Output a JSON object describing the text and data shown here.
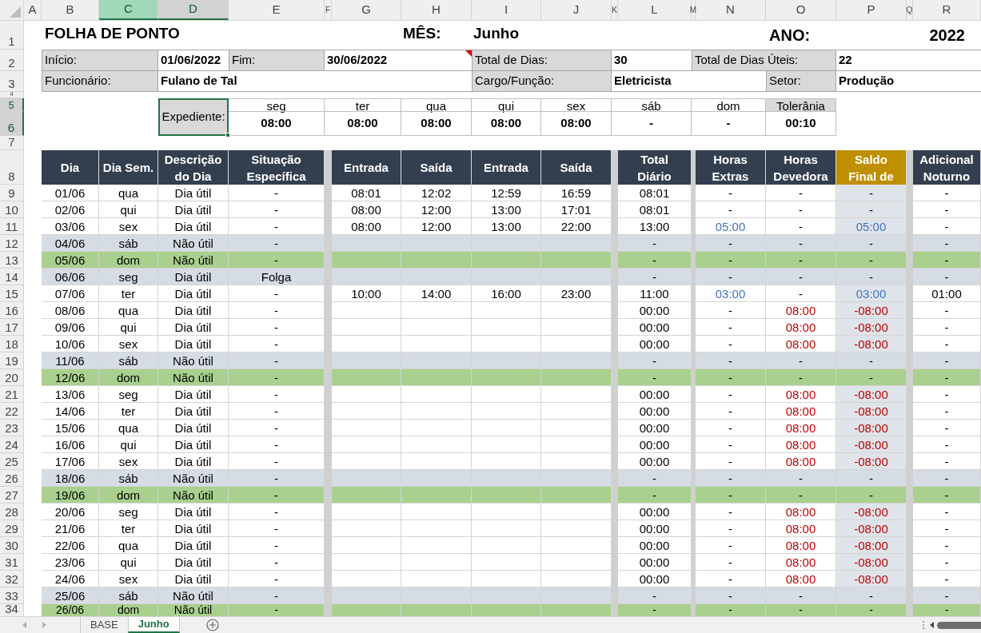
{
  "column_headers": [
    {
      "label": "A",
      "selected": false,
      "highlighted": false
    },
    {
      "label": "B",
      "selected": false,
      "highlighted": false
    },
    {
      "label": "C",
      "selected": true,
      "highlighted": true
    },
    {
      "label": "D",
      "selected": false,
      "highlighted": true
    },
    {
      "label": "E",
      "selected": false,
      "highlighted": false
    },
    {
      "label": "F",
      "selected": false,
      "highlighted": false
    },
    {
      "label": "G",
      "selected": false,
      "highlighted": false
    },
    {
      "label": "H",
      "selected": false,
      "highlighted": false
    },
    {
      "label": "I",
      "selected": false,
      "highlighted": false
    },
    {
      "label": "J",
      "selected": false,
      "highlighted": false
    },
    {
      "label": "K",
      "selected": false,
      "highlighted": false
    },
    {
      "label": "L",
      "selected": false,
      "highlighted": false
    },
    {
      "label": "M",
      "selected": false,
      "highlighted": false
    },
    {
      "label": "N",
      "selected": false,
      "highlighted": false
    },
    {
      "label": "O",
      "selected": false,
      "highlighted": false
    },
    {
      "label": "P",
      "selected": false,
      "highlighted": false
    },
    {
      "label": "Q",
      "selected": false,
      "highlighted": false
    },
    {
      "label": "R",
      "selected": false,
      "highlighted": false
    }
  ],
  "row_numbers": [
    {
      "label": "1",
      "highlighted": false
    },
    {
      "label": "2",
      "highlighted": false
    },
    {
      "label": "3",
      "highlighted": false
    },
    {
      "label": "4",
      "highlighted": false
    },
    {
      "label": "5",
      "highlighted": true
    },
    {
      "label": "6",
      "highlighted": true
    },
    {
      "label": "7",
      "highlighted": false
    },
    {
      "label": "8",
      "highlighted": false
    },
    {
      "label": "9",
      "highlighted": false
    },
    {
      "label": "10",
      "highlighted": false
    },
    {
      "label": "11",
      "highlighted": false
    },
    {
      "label": "12",
      "highlighted": false
    },
    {
      "label": "13",
      "highlighted": false
    },
    {
      "label": "14",
      "highlighted": false
    },
    {
      "label": "15",
      "highlighted": false
    },
    {
      "label": "16",
      "highlighted": false
    },
    {
      "label": "17",
      "highlighted": false
    },
    {
      "label": "18",
      "highlighted": false
    },
    {
      "label": "19",
      "highlighted": false
    },
    {
      "label": "20",
      "highlighted": false
    },
    {
      "label": "21",
      "highlighted": false
    },
    {
      "label": "22",
      "highlighted": false
    },
    {
      "label": "23",
      "highlighted": false
    },
    {
      "label": "24",
      "highlighted": false
    },
    {
      "label": "25",
      "highlighted": false
    },
    {
      "label": "26",
      "highlighted": false
    },
    {
      "label": "27",
      "highlighted": false
    },
    {
      "label": "28",
      "highlighted": false
    },
    {
      "label": "29",
      "highlighted": false
    },
    {
      "label": "30",
      "highlighted": false
    },
    {
      "label": "31",
      "highlighted": false
    },
    {
      "label": "32",
      "highlighted": false
    },
    {
      "label": "33",
      "highlighted": false
    },
    {
      "label": "34",
      "highlighted": false
    }
  ],
  "sheet_title": "FOLHA DE PONTO",
  "month": {
    "label": "MÊS:",
    "value": "Junho"
  },
  "year": {
    "label": "ANO:",
    "value": "2022"
  },
  "info": {
    "start": {
      "label": "Início:",
      "value": "01/06/2022"
    },
    "end": {
      "label": "Fim:",
      "value": "30/06/2022"
    },
    "total_days": {
      "label": "Total de Dias:",
      "value": "30"
    },
    "working_days": {
      "label": "Total de Dias Úteis:",
      "value": "22"
    },
    "employee": {
      "label": "Funcionário:",
      "value": "Fulano de Tal"
    },
    "role": {
      "label": "Cargo/Função:",
      "value": "Eletricista"
    },
    "sector": {
      "label": "Setor:",
      "value": "Produção"
    }
  },
  "schedule": {
    "label": "Expediente:",
    "days": [
      {
        "day": "seg",
        "hours": "08:00"
      },
      {
        "day": "ter",
        "hours": "08:00"
      },
      {
        "day": "qua",
        "hours": "08:00"
      },
      {
        "day": "qui",
        "hours": "08:00"
      },
      {
        "day": "sex",
        "hours": "08:00"
      },
      {
        "day": "sáb",
        "hours": "-"
      },
      {
        "day": "dom",
        "hours": "-"
      }
    ],
    "tolerance": {
      "label": "Tolerânia",
      "value": "00:10"
    }
  },
  "table": {
    "columns": [
      {
        "label": "Dia",
        "highlighted": false
      },
      {
        "label": "Dia Sem.",
        "highlighted": false
      },
      {
        "label": "Descrição do Dia",
        "highlighted": false
      },
      {
        "label": "Situação Específica",
        "highlighted": false
      },
      {
        "label": "Entrada",
        "highlighted": false
      },
      {
        "label": "Saída",
        "highlighted": false
      },
      {
        "label": "Entrada",
        "highlighted": false
      },
      {
        "label": "Saída",
        "highlighted": false
      },
      {
        "label": "Total Diário",
        "highlighted": false
      },
      {
        "label": "Horas Extras",
        "highlighted": false
      },
      {
        "label": "Horas Devedora",
        "highlighted": false
      },
      {
        "label": "Saldo Final de",
        "highlighted": true
      },
      {
        "label": "Adicional Noturno",
        "highlighted": false
      }
    ],
    "rows": [
      {
        "day": "01/06",
        "weekday": "qua",
        "description": "Dia útil",
        "situation": "-",
        "kind": "workday",
        "punches": [
          "08:01",
          "12:02",
          "12:59",
          "16:59"
        ],
        "total": "08:01",
        "extras": "-",
        "owed": "-",
        "balance": "-",
        "night": "-",
        "overtime": false,
        "deficit": false
      },
      {
        "day": "02/06",
        "weekday": "qui",
        "description": "Dia útil",
        "situation": "-",
        "kind": "workday",
        "punches": [
          "08:00",
          "12:00",
          "13:00",
          "17:01"
        ],
        "total": "08:01",
        "extras": "-",
        "owed": "-",
        "balance": "-",
        "night": "-",
        "overtime": false,
        "deficit": false
      },
      {
        "day": "03/06",
        "weekday": "sex",
        "description": "Dia útil",
        "situation": "-",
        "kind": "workday",
        "punches": [
          "08:00",
          "12:00",
          "13:00",
          "22:00"
        ],
        "total": "13:00",
        "extras": "05:00",
        "owed": "-",
        "balance": "05:00",
        "night": "-",
        "overtime": true,
        "deficit": false
      },
      {
        "day": "04/06",
        "weekday": "sáb",
        "description": "Não útil",
        "situation": "-",
        "kind": "saturday",
        "total": "-",
        "extras": "-",
        "owed": "-",
        "balance": "-",
        "night": "-",
        "overtime": false,
        "deficit": false
      },
      {
        "day": "05/06",
        "weekday": "dom",
        "description": "Não útil",
        "situation": "-",
        "kind": "sunday",
        "total": "-",
        "extras": "-",
        "owed": "-",
        "balance": "-",
        "night": "-",
        "overtime": false,
        "deficit": false
      },
      {
        "day": "06/06",
        "weekday": "seg",
        "description": "Dia útil",
        "situation": "Folga",
        "kind": "leave",
        "total": "-",
        "extras": "-",
        "owed": "-",
        "balance": "-",
        "night": "-",
        "overtime": false,
        "deficit": false
      },
      {
        "day": "07/06",
        "weekday": "ter",
        "description": "Dia útil",
        "situation": "-",
        "kind": "workday",
        "punches": [
          "10:00",
          "14:00",
          "16:00",
          "23:00"
        ],
        "total": "11:00",
        "extras": "03:00",
        "owed": "-",
        "balance": "03:00",
        "night": "01:00",
        "overtime": true,
        "deficit": false
      },
      {
        "day": "08/06",
        "weekday": "qua",
        "description": "Dia útil",
        "situation": "-",
        "kind": "workday",
        "total": "00:00",
        "extras": "-",
        "owed": "08:00",
        "balance": "-08:00",
        "night": "-",
        "overtime": false,
        "deficit": true
      },
      {
        "day": "09/06",
        "weekday": "qui",
        "description": "Dia útil",
        "situation": "-",
        "kind": "workday",
        "total": "00:00",
        "extras": "-",
        "owed": "08:00",
        "balance": "-08:00",
        "night": "-",
        "overtime": false,
        "deficit": true
      },
      {
        "day": "10/06",
        "weekday": "sex",
        "description": "Dia útil",
        "situation": "-",
        "kind": "workday",
        "total": "00:00",
        "extras": "-",
        "owed": "08:00",
        "balance": "-08:00",
        "night": "-",
        "overtime": false,
        "deficit": true
      },
      {
        "day": "11/06",
        "weekday": "sáb",
        "description": "Não útil",
        "situation": "-",
        "kind": "saturday",
        "total": "-",
        "extras": "-",
        "owed": "-",
        "balance": "-",
        "night": "-",
        "overtime": false,
        "deficit": false
      },
      {
        "day": "12/06",
        "weekday": "dom",
        "description": "Não útil",
        "situation": "-",
        "kind": "sunday",
        "total": "-",
        "extras": "-",
        "owed": "-",
        "balance": "-",
        "night": "-",
        "overtime": false,
        "deficit": false
      },
      {
        "day": "13/06",
        "weekday": "seg",
        "description": "Dia útil",
        "situation": "-",
        "kind": "workday",
        "total": "00:00",
        "extras": "-",
        "owed": "08:00",
        "balance": "-08:00",
        "night": "-",
        "overtime": false,
        "deficit": true
      },
      {
        "day": "14/06",
        "weekday": "ter",
        "description": "Dia útil",
        "situation": "-",
        "kind": "workday",
        "total": "00:00",
        "extras": "-",
        "owed": "08:00",
        "balance": "-08:00",
        "night": "-",
        "overtime": false,
        "deficit": true
      },
      {
        "day": "15/06",
        "weekday": "qua",
        "description": "Dia útil",
        "situation": "-",
        "kind": "workday",
        "total": "00:00",
        "extras": "-",
        "owed": "08:00",
        "balance": "-08:00",
        "night": "-",
        "overtime": false,
        "deficit": true
      },
      {
        "day": "16/06",
        "weekday": "qui",
        "description": "Dia útil",
        "situation": "-",
        "kind": "workday",
        "total": "00:00",
        "extras": "-",
        "owed": "08:00",
        "balance": "-08:00",
        "night": "-",
        "overtime": false,
        "deficit": true
      },
      {
        "day": "17/06",
        "weekday": "sex",
        "description": "Dia útil",
        "situation": "-",
        "kind": "workday",
        "total": "00:00",
        "extras": "-",
        "owed": "08:00",
        "balance": "-08:00",
        "night": "-",
        "overtime": false,
        "deficit": true
      },
      {
        "day": "18/06",
        "weekday": "sáb",
        "description": "Não útil",
        "situation": "-",
        "kind": "saturday",
        "total": "-",
        "extras": "-",
        "owed": "-",
        "balance": "-",
        "night": "-",
        "overtime": false,
        "deficit": false
      },
      {
        "day": "19/06",
        "weekday": "dom",
        "description": "Não útil",
        "situation": "-",
        "kind": "sunday",
        "total": "-",
        "extras": "-",
        "owed": "-",
        "balance": "-",
        "night": "-",
        "overtime": false,
        "deficit": false
      },
      {
        "day": "20/06",
        "weekday": "seg",
        "description": "Dia útil",
        "situation": "-",
        "kind": "workday",
        "total": "00:00",
        "extras": "-",
        "owed": "08:00",
        "balance": "-08:00",
        "night": "-",
        "overtime": false,
        "deficit": true
      },
      {
        "day": "21/06",
        "weekday": "ter",
        "description": "Dia útil",
        "situation": "-",
        "kind": "workday",
        "total": "00:00",
        "extras": "-",
        "owed": "08:00",
        "balance": "-08:00",
        "night": "-",
        "overtime": false,
        "deficit": true
      },
      {
        "day": "22/06",
        "weekday": "qua",
        "description": "Dia útil",
        "situation": "-",
        "kind": "workday",
        "total": "00:00",
        "extras": "-",
        "owed": "08:00",
        "balance": "-08:00",
        "night": "-",
        "overtime": false,
        "deficit": true
      },
      {
        "day": "23/06",
        "weekday": "qui",
        "description": "Dia útil",
        "situation": "-",
        "kind": "workday",
        "total": "00:00",
        "extras": "-",
        "owed": "08:00",
        "balance": "-08:00",
        "night": "-",
        "overtime": false,
        "deficit": true
      },
      {
        "day": "24/06",
        "weekday": "sex",
        "description": "Dia útil",
        "situation": "-",
        "kind": "workday",
        "total": "00:00",
        "extras": "-",
        "owed": "08:00",
        "balance": "-08:00",
        "night": "-",
        "overtime": false,
        "deficit": true
      },
      {
        "day": "25/06",
        "weekday": "sáb",
        "description": "Não útil",
        "situation": "-",
        "kind": "saturday",
        "total": "-",
        "extras": "-",
        "owed": "-",
        "balance": "-",
        "night": "-",
        "overtime": false,
        "deficit": false
      },
      {
        "day": "26/06",
        "weekday": "dom",
        "description": "Não útil",
        "situation": "-",
        "kind": "sunday",
        "total": "-",
        "extras": "-",
        "owed": "-",
        "balance": "-",
        "night": "-",
        "overtime": false,
        "deficit": false
      }
    ]
  },
  "sheet_tabs": [
    {
      "label": "BASE",
      "selected": false
    },
    {
      "label": "Junho",
      "selected": true
    }
  ]
}
